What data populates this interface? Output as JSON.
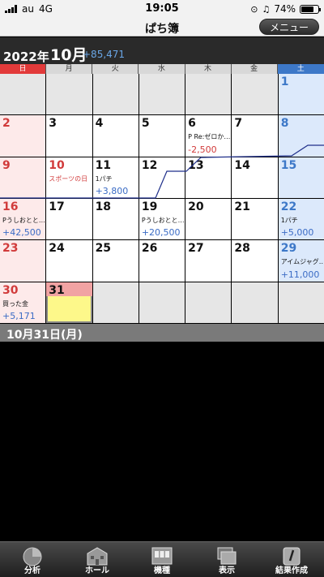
{
  "status": {
    "carrier": "au",
    "network": "4G",
    "time": "19:05",
    "battery": "74%",
    "battery_level": 0.74
  },
  "nav": {
    "title": "ぱち簿",
    "menu_label": "メニュー"
  },
  "month": {
    "year": "2022年",
    "month": "10月",
    "total": "+85,471"
  },
  "weekdays": [
    "日",
    "月",
    "火",
    "水",
    "木",
    "金",
    "土"
  ],
  "days": {
    "d1": "1",
    "d2": "2",
    "d3": "3",
    "d4": "4",
    "d5": "5",
    "d6": "6",
    "d7": "7",
    "d8": "8",
    "d9": "9",
    "d10": "10",
    "d11": "11",
    "d12": "12",
    "d13": "13",
    "d14": "14",
    "d15": "15",
    "d16": "16",
    "d17": "17",
    "d18": "18",
    "d19": "19",
    "d20": "20",
    "d21": "21",
    "d22": "22",
    "d23": "23",
    "d24": "24",
    "d25": "25",
    "d26": "26",
    "d27": "27",
    "d28": "28",
    "d29": "29",
    "d30": "30",
    "d31": "31"
  },
  "entries": {
    "d6": {
      "memo": "P Re:ゼロか…",
      "amount": "-2,500"
    },
    "d10": {
      "holiday": "スポーツの日"
    },
    "d11": {
      "memo": "1パチ",
      "amount": "+3,800"
    },
    "d16": {
      "memo": "Pうしおとと…",
      "amount": "+42,500"
    },
    "d19": {
      "memo": "Pうしおとと…",
      "amount": "+20,500"
    },
    "d22": {
      "memo": "1パチ",
      "amount": "+5,000"
    },
    "d29": {
      "memo": "アイムジャグ…",
      "amount": "+11,000"
    },
    "d30": {
      "memo": "買った金",
      "amount": "+5,171"
    }
  },
  "selected_date": "10月31日(月)",
  "tabs": [
    {
      "label": "分析",
      "icon": "pie-chart-icon"
    },
    {
      "label": "ホール",
      "icon": "building-icon"
    },
    {
      "label": "機種",
      "icon": "slot-machine-icon"
    },
    {
      "label": "表示",
      "icon": "display-icon"
    },
    {
      "label": "結果作成",
      "icon": "edit-icon"
    }
  ],
  "colors": {
    "sunday": "#e23a3a",
    "saturday": "#3d78c8",
    "positive": "#3b6cc5",
    "negative": "#d13b3b",
    "today": "#fdf88a",
    "trend_line": "#1f2f8a"
  }
}
